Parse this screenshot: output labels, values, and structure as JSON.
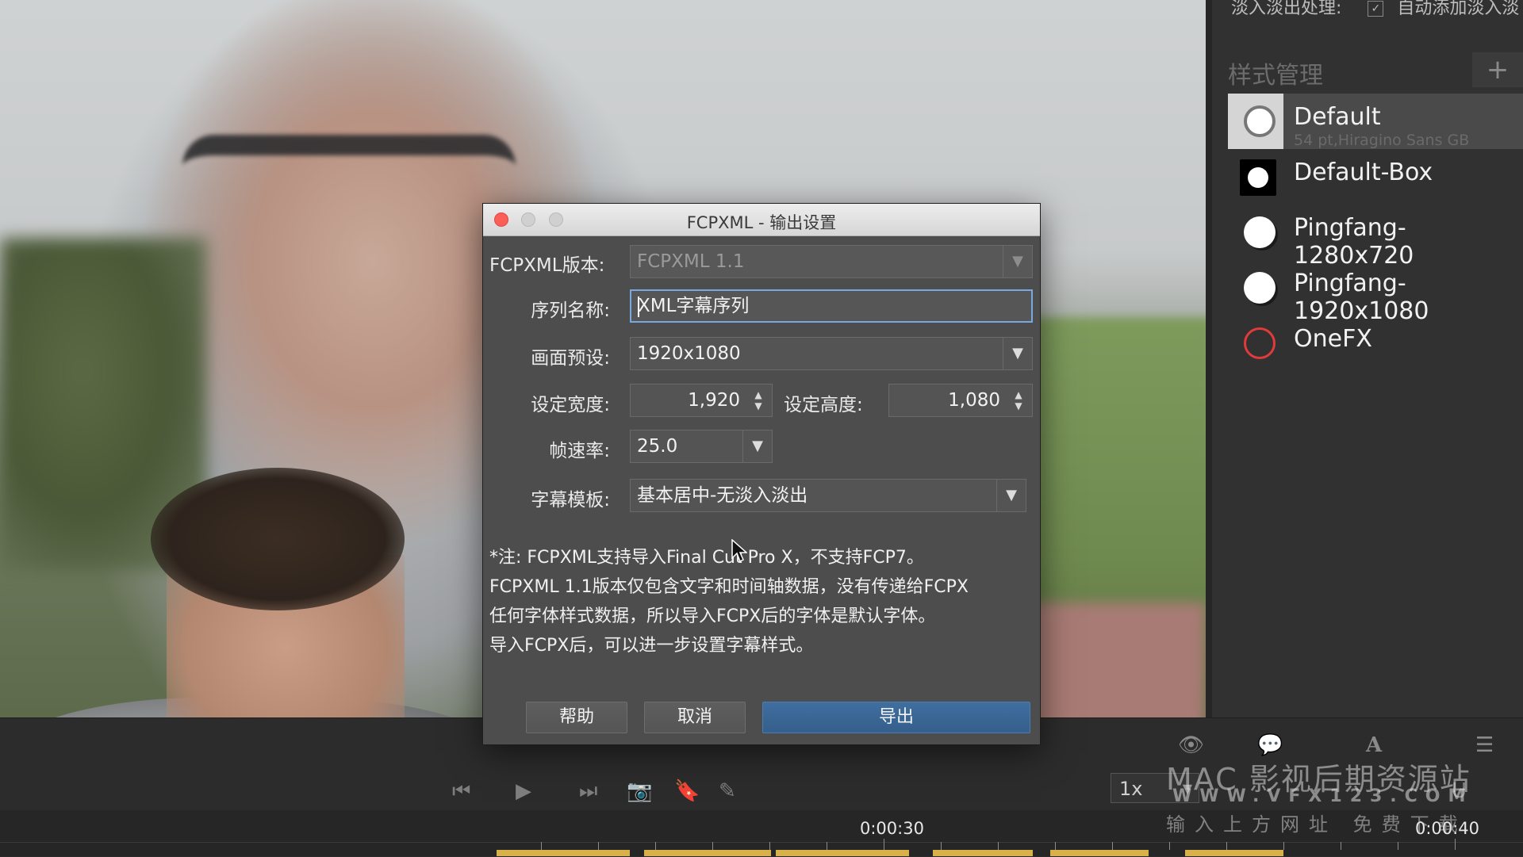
{
  "right_panel": {
    "top_label": "淡入淡出处理:",
    "top_checkbox_label": "自动添加淡入淡",
    "section_title": "样式管理",
    "add_icon": "plus-icon",
    "styles": [
      {
        "name": "Default",
        "sub": "54 pt,Hiragino Sans GB",
        "swatch": "white-ring",
        "selected": true
      },
      {
        "name": "Default-Box",
        "sub": "",
        "swatch": "white-box"
      },
      {
        "name": "Pingfang-1280x720",
        "sub": "",
        "swatch": "white"
      },
      {
        "name": "Pingfang-1920x1080",
        "sub": "",
        "swatch": "white"
      },
      {
        "name": "OneFX",
        "sub": "",
        "swatch": "red-ring"
      }
    ]
  },
  "dialog": {
    "title": "FCPXML - 输出设置",
    "version_label": "FCPXML版本:",
    "version_value": "FCPXML 1.1",
    "sequence_label": "序列名称:",
    "sequence_value": "XML字幕序列",
    "preset_label": "画面预设:",
    "preset_value": "1920x1080",
    "width_label": "设定宽度:",
    "width_value": "1,920",
    "height_label": "设定高度:",
    "height_value": "1,080",
    "fps_label": "帧速率:",
    "fps_value": "25.0",
    "template_label": "字幕模板:",
    "template_value": "基本居中-无淡入淡出",
    "note_lines": [
      "*注: FCPXML支持导入Final Cut Pro X，不支持FCP7。",
      "FCPXML 1.1版本仅包含文字和时间轴数据，没有传递给FCPX",
      "任何字体样式数据，所以导入FCPX后的字体是默认字体。",
      "导入FCPX后，可以进一步设置字幕样式。"
    ],
    "help_button": "帮助",
    "cancel_button": "取消",
    "export_button": "导出"
  },
  "playback": {
    "speed": "1x",
    "timecode_1": "0:00:30",
    "timecode_2": "0:00:40"
  },
  "watermark": {
    "line1": "MAC 影视后期资源站",
    "line2": "WWW.VFX123.COM",
    "line3": "输入上方网址 免费下载"
  },
  "colors": {
    "accent_blue": "#3f6e9f",
    "close_red": "#fc5f57",
    "clip_yellow": "#d8b14a"
  }
}
